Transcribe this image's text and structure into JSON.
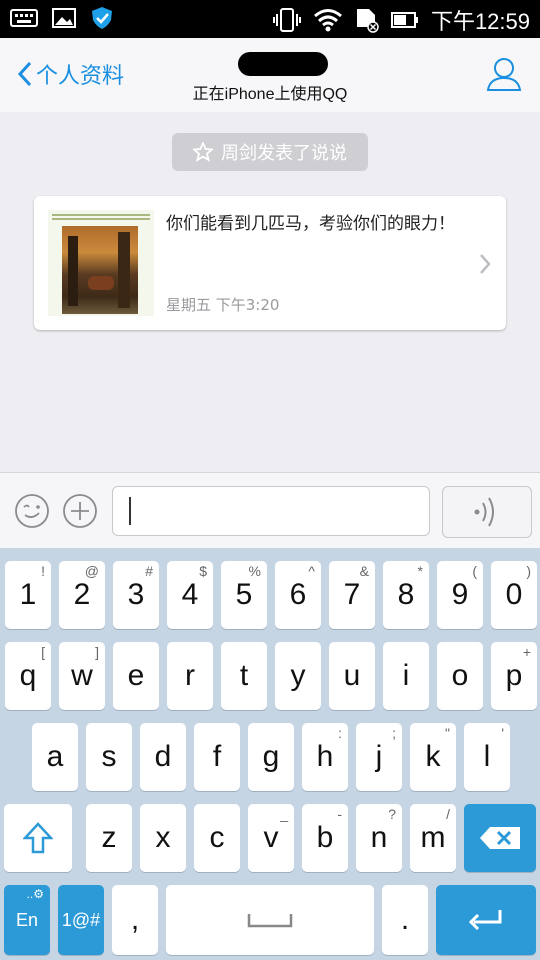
{
  "status_bar": {
    "time": "下午12:59"
  },
  "header": {
    "back_label": "个人资料",
    "subtitle": "正在iPhone上使用QQ"
  },
  "chat": {
    "notice": "周剑发表了说说",
    "card": {
      "text": "你们能看到几匹马，考验你们的眼力！",
      "time": "星期五 下午3:20"
    }
  },
  "keyboard": {
    "number_row": [
      {
        "main": "1",
        "sub": "!"
      },
      {
        "main": "2",
        "sub": "@"
      },
      {
        "main": "3",
        "sub": "#"
      },
      {
        "main": "4",
        "sub": "$"
      },
      {
        "main": "5",
        "sub": "%"
      },
      {
        "main": "6",
        "sub": "^"
      },
      {
        "main": "7",
        "sub": "&"
      },
      {
        "main": "8",
        "sub": "*"
      },
      {
        "main": "9",
        "sub": "("
      },
      {
        "main": "0",
        "sub": ")"
      }
    ],
    "row1": [
      {
        "main": "q",
        "sub": "["
      },
      {
        "main": "w",
        "sub": "]"
      },
      {
        "main": "e",
        "sub": ""
      },
      {
        "main": "r",
        "sub": ""
      },
      {
        "main": "t",
        "sub": ""
      },
      {
        "main": "y",
        "sub": ""
      },
      {
        "main": "u",
        "sub": ""
      },
      {
        "main": "i",
        "sub": ""
      },
      {
        "main": "o",
        "sub": ""
      },
      {
        "main": "p",
        "sub": "+"
      }
    ],
    "row2": [
      {
        "main": "a",
        "sub": ""
      },
      {
        "main": "s",
        "sub": ""
      },
      {
        "main": "d",
        "sub": ""
      },
      {
        "main": "f",
        "sub": ""
      },
      {
        "main": "g",
        "sub": ""
      },
      {
        "main": "h",
        "sub": ":"
      },
      {
        "main": "j",
        "sub": ";"
      },
      {
        "main": "k",
        "sub": "\""
      },
      {
        "main": "l",
        "sub": "'"
      }
    ],
    "row3": [
      {
        "main": "z",
        "sub": ""
      },
      {
        "main": "x",
        "sub": ""
      },
      {
        "main": "c",
        "sub": ""
      },
      {
        "main": "v",
        "sub": "_"
      },
      {
        "main": "b",
        "sub": "-"
      },
      {
        "main": "n",
        "sub": "?"
      },
      {
        "main": "m",
        "sub": "/"
      }
    ],
    "lang_key": "En",
    "symbol_key": "1@#",
    "comma_key": ",",
    "period_key": "."
  }
}
